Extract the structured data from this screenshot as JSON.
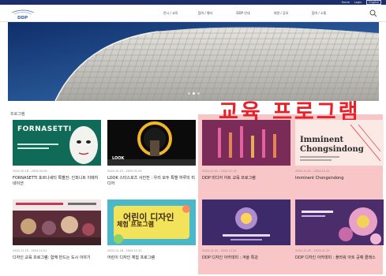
{
  "header": {
    "util_links": [
      "Home",
      "Login",
      "English"
    ],
    "nav": [
      "전시 / 교육",
      "참여 / 행사",
      "DDP 안내",
      "대관 / 공모",
      "참여 / 소통"
    ]
  },
  "hero": {
    "slide_count": 3,
    "active_slide": 2
  },
  "section": {
    "title": "프로그램",
    "highlight_label": "교육 프로그램"
  },
  "cards": [
    {
      "thumb_line1": "FORNASETTI",
      "thumb_line2": "",
      "meta": "2024.10.18 - 2025.02.09",
      "title": "FORNASETTI 포르나세티 특별전: 인피니트 이매지네이션"
    },
    {
      "thumb_line1": "",
      "thumb_line2": "LOOK",
      "meta": "2024.10.15 - 2025.01.05",
      "title": "LOOK 스타스포츠 사진전 : 우리 모두 특별 하루의 미디어"
    },
    {
      "thumb_line1": "",
      "thumb_line2": "",
      "meta": "2024.11.01 - 2024.12.15",
      "title": "DDP 미디어 아트 교육 프로그램"
    },
    {
      "thumb_line1": "Imminent",
      "thumb_line2": "Chongsindong",
      "meta": "2024.11.01 - 2024.12.31",
      "title": "Imminent Chongsindong"
    },
    {
      "thumb_line1": "",
      "thumb_line2": "",
      "meta": "2024.11.10 - 2024.12.01",
      "title": "디자인 교육 프로그램: 함께 만드는 도시 이야기"
    },
    {
      "thumb_line1": "어린이 디자인",
      "thumb_line2": "체험 프로그램",
      "meta": "2024.11.16 - 2024.12.22",
      "title": "어린이 디자인 체험 프로그램"
    },
    {
      "thumb_line1": "",
      "thumb_line2": "",
      "meta": "2024.12.02 - 2024.12.20",
      "title": "DDP 디자인 아카데미 : 겨울 특강"
    },
    {
      "thumb_line1": "",
      "thumb_line2": "",
      "meta": "2024.12.05 - 2025.01.10",
      "title": "DDP 디자인 아카데미 : 플라워 아트 공예 클래스"
    }
  ]
}
